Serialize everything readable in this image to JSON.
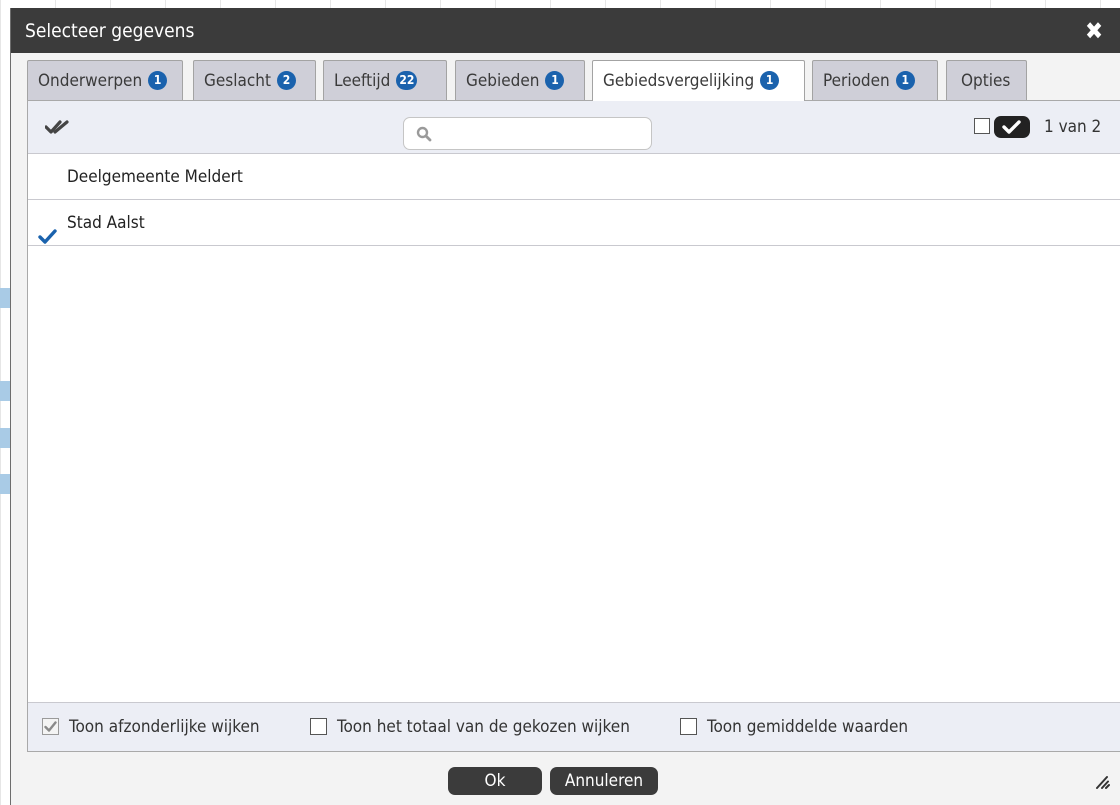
{
  "dialog": {
    "title": "Selecteer gegevens",
    "close_icon": "close-icon"
  },
  "tabs": [
    {
      "label": "Onderwerpen",
      "badge": "1"
    },
    {
      "label": "Geslacht",
      "badge": "2"
    },
    {
      "label": "Leeftijd",
      "badge": "22"
    },
    {
      "label": "Gebieden",
      "badge": "1"
    },
    {
      "label": "Gebiedsvergelijking",
      "badge": "1",
      "active": true
    },
    {
      "label": "Perioden",
      "badge": "1"
    },
    {
      "label": "Opties",
      "badge": ""
    }
  ],
  "toolbar": {
    "select_all_icon": "double-check-icon",
    "search_icon": "search-icon",
    "search_value": "",
    "search_placeholder": "",
    "count": "1 van 2"
  },
  "items": [
    {
      "label": "Deelgemeente Meldert",
      "selected": false
    },
    {
      "label": "Stad Aalst",
      "selected": true
    }
  ],
  "options": [
    {
      "label": "Toon afzonderlijke wijken",
      "checked": true
    },
    {
      "label": "Toon het totaal van de gekozen wijken",
      "checked": false
    },
    {
      "label": "Toon gemiddelde waarden",
      "checked": false
    }
  ],
  "buttons": {
    "ok": "Ok",
    "cancel": "Annuleren"
  },
  "colors": {
    "titlebar": "#3b3b3b",
    "badge": "#1a62ad",
    "check": "#1a62ad"
  }
}
